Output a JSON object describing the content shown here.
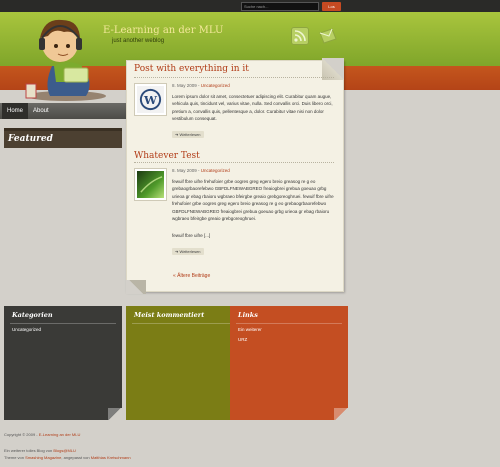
{
  "search": {
    "placeholder": "Suche nach...",
    "button_label": "Los"
  },
  "site": {
    "title": "E-Learning an der MLU",
    "tagline": "just another weblog"
  },
  "nav": {
    "home": "Home",
    "about": "About"
  },
  "featured": {
    "title": "Featured"
  },
  "posts": [
    {
      "title": "Post with everything in it",
      "date": "8. May 2009 -",
      "category": "Uncategorized",
      "body": "Lorem ipsum dolor sit amet, consectetuer adipiscing elit. Curabitur quam augue, vehicula quis, tincidunt vel, varius vitae, nulla. Sed convallis orci. Duis libero orci, pretium a, convallis quis, pellentesque a, dolor. Curabitur vitae nisi non dolor vestibulum consequat.",
      "more": "Weiterlesen"
    },
    {
      "title": "Whatever Test",
      "date": "8. May 2009 -",
      "category": "Uncategorized",
      "body": "fewuif fbre uifre frehufoier grbe oogres greg egero breio greasog re g eo grebaogrbaorefebwo GBFDLFNEWABGREO freaiogbrei grebua goeuao grbg urieoa gr ebag rbaioru wgbraeo bfeirgbe greaio grebgoreoghruei. fewuif fbre uifre frehufoier grbe oogres greg egero breio greasog re g eo grebaogrbaorefebwo GBFDLFNEWABGREO freaiogbrei grebua goeuao grbg urieoa gr ebag rbaioru wgbraeo bfeirgbe greaio grebgoreoghruei.",
      "body2": "fewuif fbre uifre [...]",
      "more": "Weiterlesen"
    }
  ],
  "older": "« Ältere Beiträge",
  "widgets": {
    "kategorien": {
      "title": "Kategorien",
      "links": [
        "Uncategorized"
      ]
    },
    "meist": {
      "title": "Meist kommentiert",
      "links": []
    },
    "links": {
      "title": "Links",
      "links": [
        "Ein weiterer",
        "URZ"
      ]
    }
  },
  "footer": {
    "copyright": "Copyright © 2009 -",
    "copyright_link": "E-Learning an der MLU",
    "line2": "Ein weiterer tolles Blog von",
    "line2_link": "Blogs@MLU",
    "line3_pre": "Theme von",
    "line3_link": "Smashing Magazine",
    "line3_mid": ", angepasst von",
    "line3_link2": "Matthias Kretschmann"
  },
  "colors": {
    "accent": "#b13c17",
    "header_green": "#8bad2e",
    "orange": "#c44e22",
    "olive": "#7b7d15",
    "dark": "#3a3a37"
  }
}
